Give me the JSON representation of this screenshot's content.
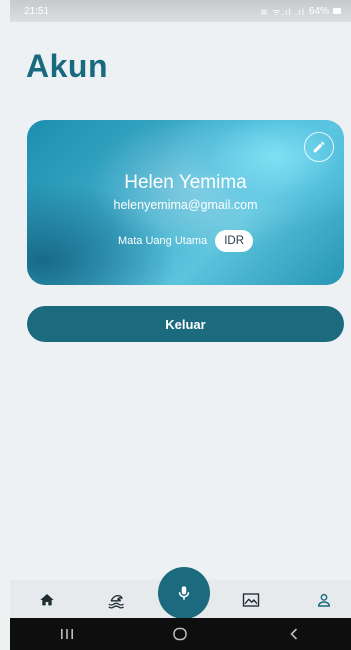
{
  "status_bar": {
    "time": "21:51",
    "signal_icons": "≋ ᯤ.ıl .ıl",
    "battery_percent": "64%"
  },
  "page": {
    "title": "Akun"
  },
  "profile": {
    "name": "Helen Yemima",
    "email": "helenyemima@gmail.com",
    "currency_label": "Mata Uang Utama",
    "currency_value": "IDR",
    "edit_icon": "pencil-icon"
  },
  "actions": {
    "logout_label": "Keluar"
  },
  "bottom_nav": {
    "items": [
      "home-icon",
      "wave-icon",
      "mic-icon",
      "chart-icon",
      "profile-icon"
    ],
    "active": "profile-icon"
  },
  "colors": {
    "primary": "#1b6a7e",
    "title": "#1a6a7f",
    "background": "#eef1f3",
    "nav_icon": "#1f2d33"
  }
}
